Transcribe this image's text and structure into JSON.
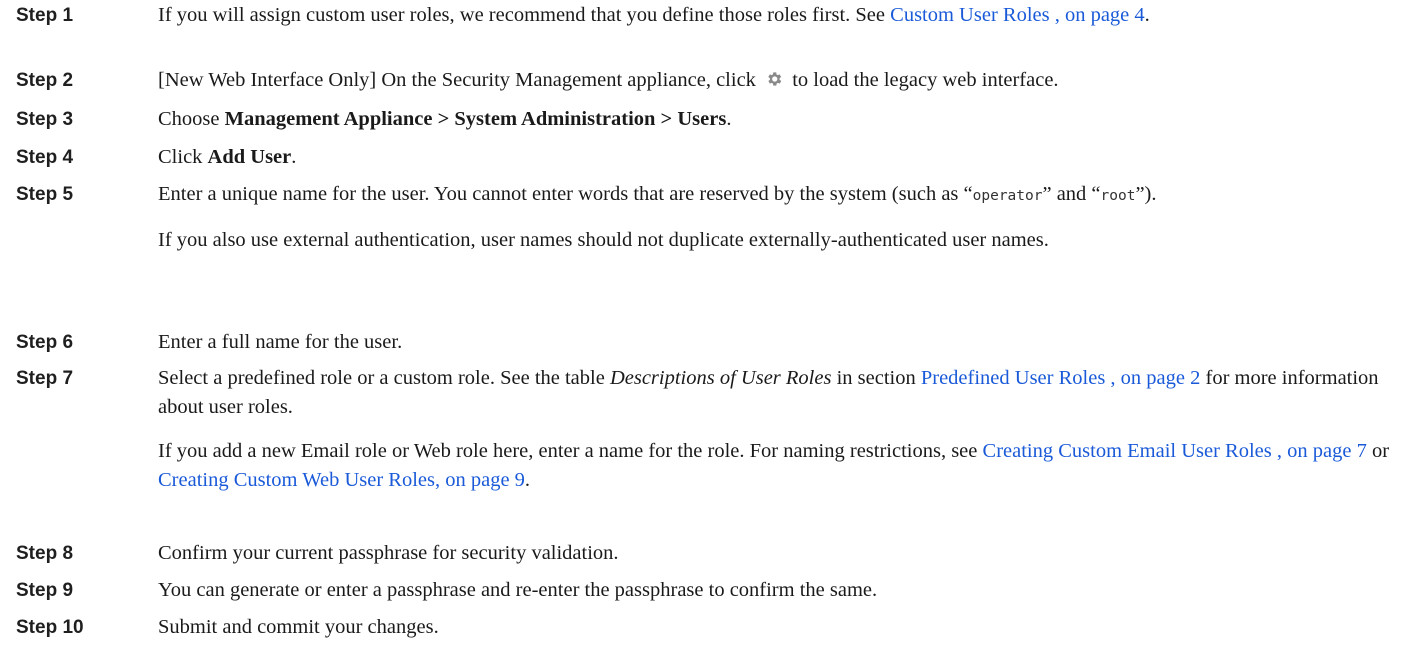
{
  "steps": [
    {
      "label": "Step 1",
      "pre": "If you will assign custom user roles, we recommend that you define those roles first. See ",
      "link": "Custom User Roles , on page 4",
      "post": "."
    },
    {
      "label": "Step 2",
      "pre": "[New Web Interface Only] On the Security Management appliance, click ",
      "icon": "gear-icon",
      "post": " to load the legacy web interface."
    },
    {
      "label": "Step 3",
      "pre": "Choose ",
      "bold": "Management Appliance > System Administration > Users",
      "post": "."
    },
    {
      "label": "Step 4",
      "pre": "Click ",
      "bold": "Add User",
      "post": "."
    },
    {
      "label": "Step 5",
      "pre": "Enter a unique name for the user. You cannot enter words that are reserved by the system (such as “",
      "code1": "operator",
      "mid": "” and “",
      "code2": "root",
      "post": "”).",
      "note": "If you also use external authentication, user names should not duplicate externally-authenticated user names."
    },
    {
      "label": "Step 6",
      "text": "Enter a full name for the user."
    },
    {
      "label": "Step 7",
      "pre": "Select a predefined role or a custom role. See the table ",
      "italic": "Descriptions of User Roles",
      "mid": " in section ",
      "link": "Predefined User Roles , on page 2",
      "post": " for more information about user roles.",
      "note_pre": "If you add a new Email role or Web role here, enter a name for the role. For naming restrictions, see ",
      "note_link1": "Creating Custom Email User Roles , on page 7",
      "note_mid": " or ",
      "note_link2": "Creating Custom Web User Roles, on page 9",
      "note_post": "."
    },
    {
      "label": "Step 8",
      "text": "Confirm your current passphrase for security validation."
    },
    {
      "label": "Step 9",
      "text": "You can generate or enter a passphrase and re-enter the passphrase to confirm the same."
    },
    {
      "label": "Step 10",
      "text": "Submit and commit your changes."
    }
  ],
  "colors": {
    "link": "#1a5ad9",
    "text": "#1a1a1a",
    "icon": "#8a8a8a"
  }
}
